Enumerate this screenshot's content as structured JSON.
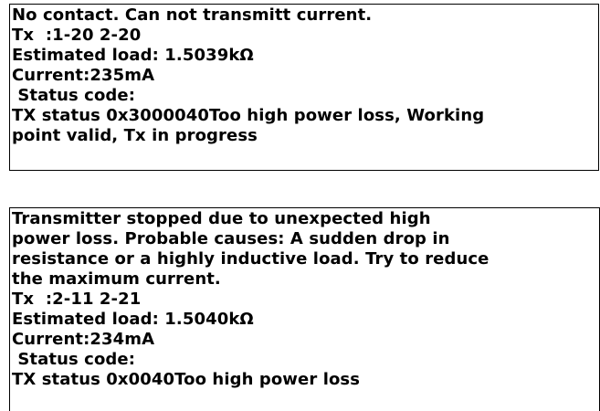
{
  "message1": {
    "lines": [
      "No contact. Can not transmitt current.",
      "Tx  :1-20 2-20",
      "Estimated load: 1.5039kΩ",
      "Current:235mA",
      " Status code:",
      "TX status 0x3000040Too high power loss, Working",
      "point valid, Tx in progress"
    ]
  },
  "message2": {
    "lines": [
      "Transmitter stopped due to unexpected high",
      "power loss. Probable causes: A sudden drop in",
      "resistance or a highly inductive load. Try to reduce",
      "the maximum current.",
      "Tx  :2-11 2-21",
      "Estimated load: 1.5040kΩ",
      "Current:234mA",
      " Status code:",
      "TX status 0x0040Too high power loss"
    ]
  }
}
